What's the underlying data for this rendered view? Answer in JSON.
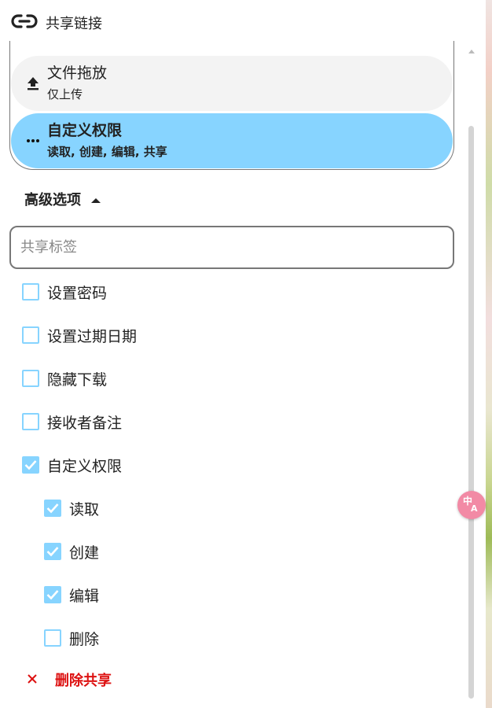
{
  "header": {
    "title": "共享链接"
  },
  "permission_options": [
    {
      "title": "文件拖放",
      "subtitle": "仅上传",
      "icon": "upload-icon",
      "selected": false
    },
    {
      "title": "自定义权限",
      "subtitle": "读取, 创建, 编辑, 共享",
      "icon": "more-horizontal-icon",
      "selected": true
    }
  ],
  "advanced": {
    "label": "高级选项",
    "expanded": true
  },
  "tag_input": {
    "placeholder": "共享标签",
    "value": ""
  },
  "options": [
    {
      "label": "设置密码",
      "checked": false
    },
    {
      "label": "设置过期日期",
      "checked": false
    },
    {
      "label": "隐藏下载",
      "checked": false
    },
    {
      "label": "接收者备注",
      "checked": false
    },
    {
      "label": "自定义权限",
      "checked": true
    }
  ],
  "custom_permissions": [
    {
      "label": "读取",
      "checked": true
    },
    {
      "label": "创建",
      "checked": true
    },
    {
      "label": "编辑",
      "checked": true
    },
    {
      "label": "删除",
      "checked": false
    }
  ],
  "delete_share": {
    "label": "删除共享"
  },
  "colors": {
    "accent": "#87d4ff",
    "danger": "#dd1111",
    "translate_button": "#f28aa5"
  }
}
